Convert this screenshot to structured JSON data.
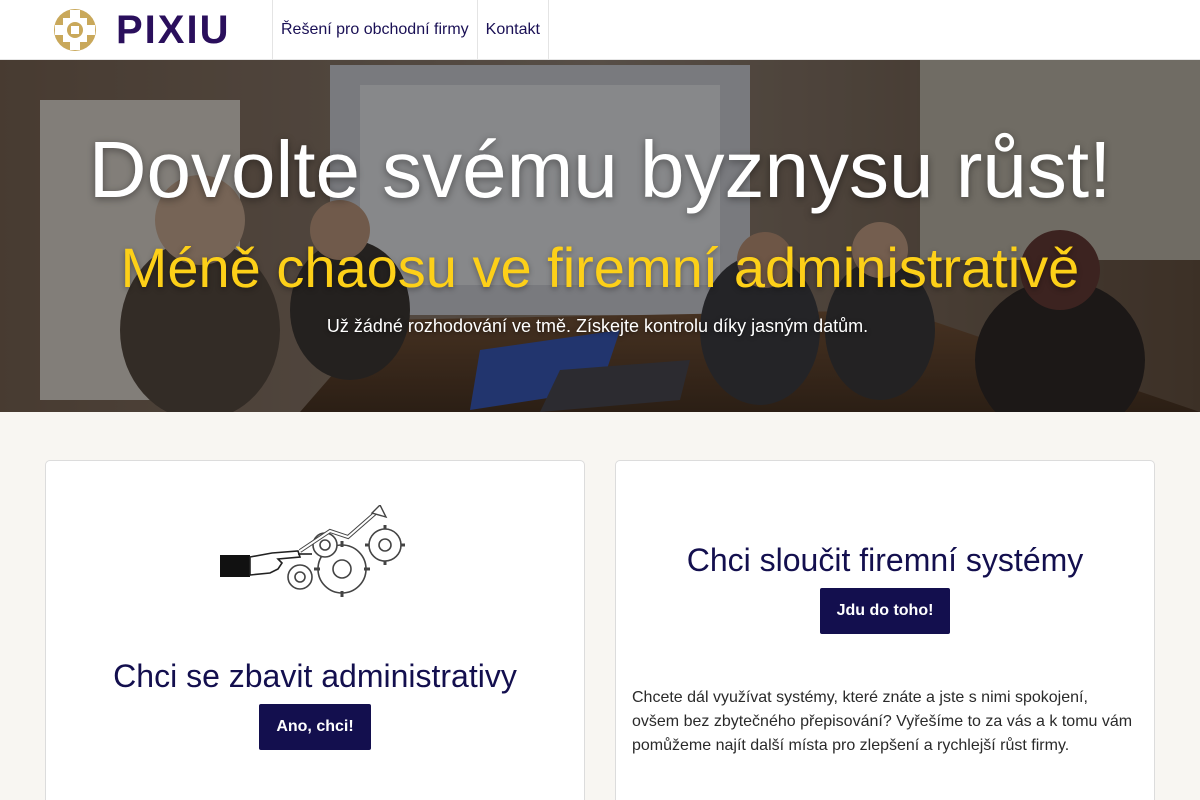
{
  "nav": {
    "brand": "PIXIU",
    "links": [
      {
        "label": "Řešení pro obchodní firmy"
      },
      {
        "label": "Kontakt"
      }
    ]
  },
  "hero": {
    "title": "Dovolte svému byznysu růst!",
    "subtitle": "Méně chaosu ve firemní administrativě",
    "tagline": "Už žádné rozhodování ve tmě. Získejte kontrolu díky jasným datům."
  },
  "cards": [
    {
      "title": "Chci se zbavit administrativy",
      "button": "Ano, chci!",
      "illustration": "hand-gears-growth-illustration"
    },
    {
      "title": "Chci sloučit firemní systémy",
      "button": "Jdu do toho!",
      "text": "Chcete dál využívat systémy, které znáte a jste s nimi spokojení, ovšem bez zbytečného přepisování? Vyřešíme to za vás a k tomu vám pomůžeme najít další místa pro zlepšení a rychlejší růst firmy."
    }
  ],
  "colors": {
    "brand_navy": "#130f4e",
    "brand_purple": "#2a0f5c",
    "accent_yellow": "#fdd018",
    "logo_gold": "#c9a85a",
    "page_bg": "#f8f6f2"
  }
}
